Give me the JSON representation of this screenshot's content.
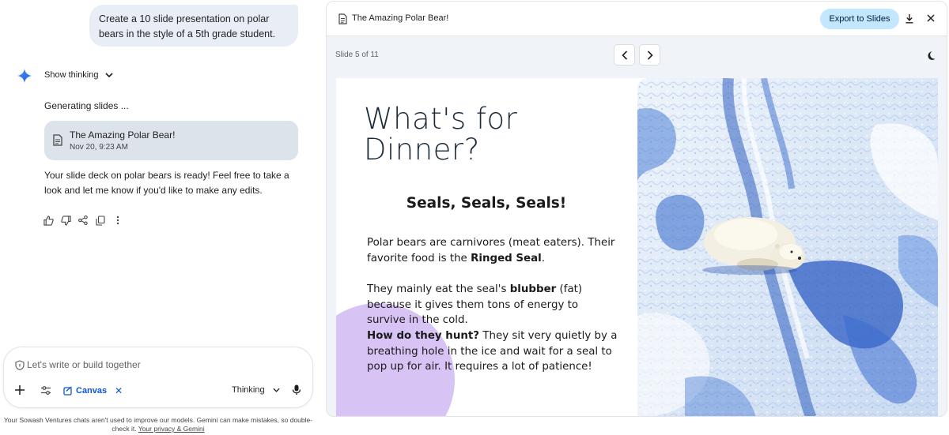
{
  "chat": {
    "user_prompt": "Create a 10 slide presentation on polar bears in the style of a 5th grade student.",
    "show_thinking_label": "Show thinking",
    "generating_label": "Generating slides ...",
    "doc_card": {
      "title": "The Amazing Polar Bear!",
      "date": "Nov 20, 9:23 AM"
    },
    "response": "Your slide deck on polar bears is ready! Feel free to take a look and let me know if you'd like to make any edits.",
    "action_icons": [
      "thumb-up-icon",
      "thumb-down-icon",
      "share-icon",
      "copy-icon",
      "more-vert-icon"
    ]
  },
  "composer": {
    "placeholder": "Let's write or build together",
    "canvas_chip_label": "Canvas",
    "thinking_label": "Thinking"
  },
  "disclaimer": {
    "text": "Your Sowash Ventures chats aren't used to improve our models. Gemini can make mistakes, so double-check it.",
    "link": "Your privacy & Gemini"
  },
  "panel": {
    "title": "The Amazing Polar Bear!",
    "export_label": "Export to Slides",
    "slide_counter": "Slide 5 of 11"
  },
  "slide": {
    "heading": "What's for Dinner?",
    "subheading": "Seals, Seals, Seals!",
    "p1_text": "Polar bears are carnivores (meat eaters). Their favorite food is the ",
    "p1_bold": "Ringed Seal",
    "p1_end": ".",
    "p2_start": "They mainly eat the seal's ",
    "p2_bold": "blubber",
    "p2_end": " (fat) because it gives them tons of energy to survive in the cold.",
    "p3_bold": "How do they hunt?",
    "p3_text": " They sit very quietly by a breathing hole in the ice and wait for a seal to pop up for air. It requires a lot of patience!"
  },
  "colors": {
    "accent_blue": "#0b57d0",
    "export_button": "#c2e7ff",
    "user_bubble": "#e9eef6",
    "doc_card": "#dde3ea",
    "slide_blob": "#d8c3f5",
    "ice_blue": "#3f6fd0"
  }
}
